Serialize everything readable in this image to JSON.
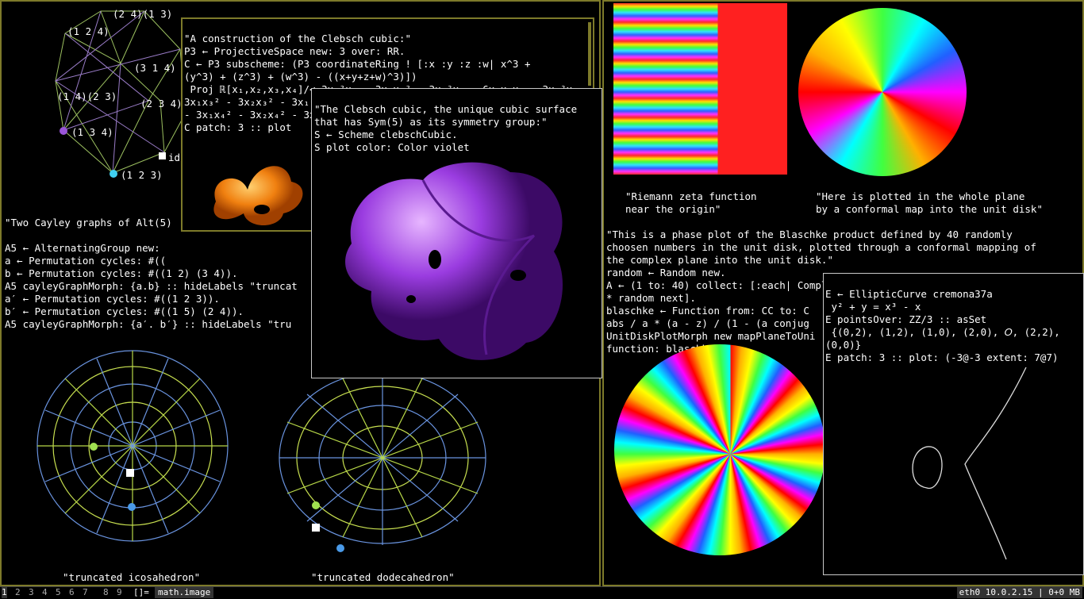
{
  "left_window": {
    "cayley_top_labels": [
      "(2 4)(1 3)",
      "(1 2 4)",
      "(3 1 4)",
      "(1 4)(2 3)",
      "(2 3 4)",
      "(1 3 4)",
      "(1 2 3)",
      "id"
    ],
    "cayley_text": [
      "\"Two Cayley graphs of Alt(5)",
      "",
      "A5 ← AlternatingGroup new:",
      "a ← Permutation cycles: #((",
      "b ← Permutation cycles: #((1 2) (3 4)).",
      "A5 cayleyGraphMorph: {a.b} :: hideLabels \"truncat",
      "a′ ← Permutation cycles: #((1 2 3)).",
      "b′ ← Permutation cycles: #((1 5) (2 4)).",
      "A5 cayleyGraphMorph: {a′. b′} :: hideLabels \"tru"
    ],
    "caption_icosahedron": "\"truncated icosahedron\"",
    "caption_dodecahedron": "\"truncated dodecahedron\""
  },
  "clebsch_construction": {
    "lines": [
      "\"A construction of the Clebsch cubic:\"",
      "P3 ← ProjectiveSpace new: 3 over: RR.",
      "C ← P3 subscheme: (P3 coordinateRing ! [:x :y :z :w| x^3 +",
      "(y^3) + (z^3) + (w^3) - ((x+y+z+w)^3)])",
      " Proj ℝ[x₁,x₂,x₃,x₄]/<-3x₁²x₂ - 3x₁x₂² - 3x₁²x₃ - 6x₁x₂x₃ - 3x₂²x₃ -",
      "3x₁x₃² - 3x₂x₃² - 3x₁²x",
      "- 3x₁x₄² - 3x₂x₄² - 3x",
      "C patch: 3 :: plot"
    ]
  },
  "clebsch_sym5": {
    "lines": [
      "\"The Clebsch cubic, the unique cubic surface",
      "that has Sym(5) as its symmetry group:\"",
      "S ← Scheme clebschCubic.",
      "S plot color: Color violet"
    ]
  },
  "right_window": {
    "zeta_caption": [
      "\"Riemann zeta function",
      "near the origin\""
    ],
    "disk_caption": [
      "\"Here is plotted in the whole plane",
      "by a conformal map into the unit disk\""
    ],
    "blaschke_text": [
      "\"This is a phase plot of the Blaschke product defined by 40 randomly",
      "choosen numbers in the unit disk, plotted through a conformal mapping of",
      "the complex plane into the unit disk.\"",
      "random ← Random new.",
      "A ← (1 to: 40) collect: [:each| Complex abs: random next arg: Float twoPi",
      "* random next].",
      "blaschke ← Function from: CC to: C",
      "abs / a * (a - z) / (1 - (a conjug",
      "UnitDiskPlotMorph new mapPlaneToUni",
      "function: blaschke"
    ]
  },
  "elliptic": {
    "lines": [
      "E ← EllipticCurve cremona37a",
      " y² + y = x³ - x",
      "E pointsOver: ZZ/3 :: asSet",
      " {(0,2), (1,2), (1,0), (2,0), 𝑂, (2,2),",
      "(0,0)}",
      "E patch: 3 :: plot: (-3@-3 extent: 7@7)"
    ]
  },
  "taskbar": {
    "workspaces": [
      "1",
      "2",
      "3",
      "4",
      "5",
      "6",
      "7",
      "8",
      "9"
    ],
    "active": "1",
    "layout": "[]=",
    "title": "math.image",
    "status": "eth0 10.0.2.15 | 0+0 MB"
  },
  "colors": {
    "frame": "#7d7a2a",
    "violet": "#9a3ce0",
    "orange": "#f08010"
  }
}
